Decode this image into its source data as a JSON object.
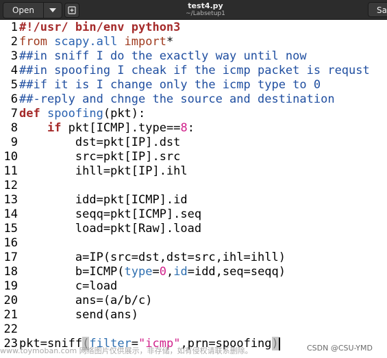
{
  "header": {
    "open_label": "Open",
    "title": "test4.py",
    "subtitle": "~/Labsetup1",
    "save_label": "Sav",
    "arrow_icon": "chevron-down-icon",
    "new_tab_icon": "new-document-icon"
  },
  "colors": {
    "comment": "#1f4ea0",
    "keyword": "#a52a2a",
    "number": "#d0208a",
    "string": "#d0208a",
    "kwarg": "#2e6fb0"
  },
  "editor": {
    "lines": [
      {
        "n": "1",
        "tokens": [
          {
            "t": "#!/usr/ bin/env python3",
            "k": "keyword"
          }
        ]
      },
      {
        "n": "2",
        "tokens": [
          {
            "t": "from",
            "k": "builtin"
          },
          {
            "t": " scapy.all ",
            "k": "module"
          },
          {
            "t": "import",
            "k": "builtin"
          },
          {
            "t": "*",
            "k": "normal"
          }
        ]
      },
      {
        "n": "3",
        "tokens": [
          {
            "t": "##in sniff I do the exactly way until now",
            "k": "comment"
          }
        ]
      },
      {
        "n": "4",
        "tokens": [
          {
            "t": "##in spoofing I cheak if the icmp packet is requst",
            "k": "comment"
          }
        ]
      },
      {
        "n": "5",
        "tokens": [
          {
            "t": "##if it is I change only the icmp type to 0",
            "k": "comment"
          }
        ]
      },
      {
        "n": "6",
        "tokens": [
          {
            "t": "##-reply and chnge the source and destination",
            "k": "comment"
          }
        ]
      },
      {
        "n": "7",
        "tokens": [
          {
            "t": "def",
            "k": "keyword"
          },
          {
            "t": " spoofing",
            "k": "module"
          },
          {
            "t": "(pkt):",
            "k": "normal"
          }
        ]
      },
      {
        "n": "8",
        "tokens": [
          {
            "t": "    ",
            "k": "normal"
          },
          {
            "t": "if",
            "k": "keyword"
          },
          {
            "t": " pkt[ICMP].type==",
            "k": "normal"
          },
          {
            "t": "8",
            "k": "number"
          },
          {
            "t": ":",
            "k": "normal"
          }
        ]
      },
      {
        "n": "9",
        "tokens": [
          {
            "t": "        dst=pkt[IP].dst",
            "k": "normal"
          }
        ]
      },
      {
        "n": "10",
        "tokens": [
          {
            "t": "        src=pkt[IP].src",
            "k": "normal"
          }
        ]
      },
      {
        "n": "11",
        "tokens": [
          {
            "t": "        ihll=pkt[IP].ihl",
            "k": "normal"
          }
        ]
      },
      {
        "n": "12",
        "tokens": []
      },
      {
        "n": "13",
        "tokens": [
          {
            "t": "        idd=pkt[ICMP].id",
            "k": "normal"
          }
        ]
      },
      {
        "n": "14",
        "tokens": [
          {
            "t": "        seqq=pkt[ICMP].seq",
            "k": "normal"
          }
        ]
      },
      {
        "n": "15",
        "tokens": [
          {
            "t": "        load=pkt[Raw].load",
            "k": "normal"
          }
        ]
      },
      {
        "n": "16",
        "tokens": []
      },
      {
        "n": "17",
        "tokens": [
          {
            "t": "        a=IP(src=dst,dst=src,ihl=ihll)",
            "k": "normal"
          }
        ]
      },
      {
        "n": "18",
        "tokens": [
          {
            "t": "        b=ICMP(",
            "k": "normal"
          },
          {
            "t": "type",
            "k": "kwarg"
          },
          {
            "t": "=",
            "k": "normal"
          },
          {
            "t": "0",
            "k": "number"
          },
          {
            "t": ",",
            "k": "normal"
          },
          {
            "t": "id",
            "k": "kwarg"
          },
          {
            "t": "=idd,seq=seqq)",
            "k": "normal"
          }
        ]
      },
      {
        "n": "19",
        "tokens": [
          {
            "t": "        c=load",
            "k": "normal"
          }
        ]
      },
      {
        "n": "20",
        "tokens": [
          {
            "t": "        ans=(a/b/c)",
            "k": "normal"
          }
        ]
      },
      {
        "n": "21",
        "tokens": [
          {
            "t": "        send(ans)",
            "k": "normal"
          }
        ]
      },
      {
        "n": "22",
        "tokens": []
      },
      {
        "n": "23",
        "tokens": [
          {
            "t": "pkt=sniff",
            "k": "normal"
          },
          {
            "t": "(",
            "k": "bracket"
          },
          {
            "t": "filter",
            "k": "kwarg"
          },
          {
            "t": "=",
            "k": "normal"
          },
          {
            "t": "\"icmp\"",
            "k": "string"
          },
          {
            "t": ",prn=spoofing",
            "k": "normal"
          },
          {
            "t": ")",
            "k": "bracket"
          }
        ]
      }
    ]
  },
  "watermark": {
    "text": "www.toymoban.com 网络图片仅供展示，非存储，如有侵权请联系删除。",
    "credit": "CSDN @CSU-YMD"
  }
}
